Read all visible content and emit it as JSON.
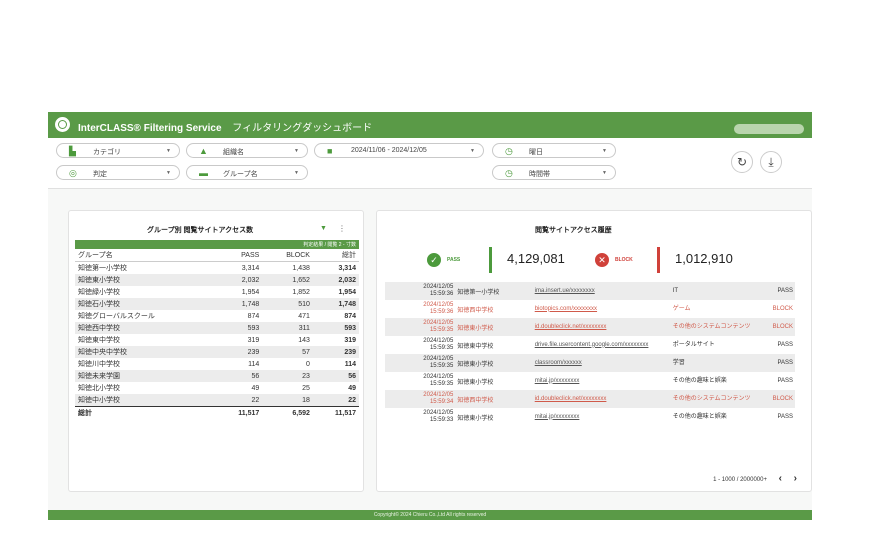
{
  "header": {
    "title": "InterCLASS® Filtering Service",
    "subtitle": "フィルタリングダッシュボード",
    "tiny_text": "",
    "button_label": ""
  },
  "filters": {
    "category": "カテゴリ",
    "school": "組織名",
    "date_range": "2024/11/06 - 2024/12/05",
    "day": "曜日",
    "judgment": "判定",
    "group": "グループ名",
    "time": "時間帯"
  },
  "group_card": {
    "title": "グループ別 閲覧サイトアクセス数",
    "subheader": "判定結果 / 閲覧 2 - 寸数",
    "columns": [
      "グループ名",
      "PASS",
      "BLOCK",
      "総計"
    ],
    "rows": [
      {
        "name": "知徳第一小学校",
        "pass": "3,314",
        "block": "1,438",
        "total": "3,314"
      },
      {
        "name": "知徳東小学校",
        "pass": "2,032",
        "block": "1,652",
        "total": "2,032"
      },
      {
        "name": "知徳緑小学校",
        "pass": "1,954",
        "block": "1,852",
        "total": "1,954"
      },
      {
        "name": "知徳石小学校",
        "pass": "1,748",
        "block": "510",
        "total": "1,748"
      },
      {
        "name": "知徳グローバルスクール",
        "pass": "874",
        "block": "471",
        "total": "874"
      },
      {
        "name": "知徳西中学校",
        "pass": "593",
        "block": "311",
        "total": "593"
      },
      {
        "name": "知徳東中学校",
        "pass": "319",
        "block": "143",
        "total": "319"
      },
      {
        "name": "知徳中央中学校",
        "pass": "239",
        "block": "57",
        "total": "239"
      },
      {
        "name": "知徳川中学校",
        "pass": "114",
        "block": "0",
        "total": "114"
      },
      {
        "name": "知徳未来学園",
        "pass": "56",
        "block": "23",
        "total": "56"
      },
      {
        "name": "知徳北小学校",
        "pass": "49",
        "block": "25",
        "total": "49"
      },
      {
        "name": "知徳中小学校",
        "pass": "22",
        "block": "18",
        "total": "22"
      }
    ],
    "sum": {
      "name": "総計",
      "pass": "11,517",
      "block": "6,592",
      "total": "11,517"
    }
  },
  "access_card": {
    "title": "閲覧サイトアクセス履歴",
    "pass_label": "PASS",
    "pass_value": "4,129,081",
    "block_label": "BLOCK",
    "block_value": "1,012,910",
    "colors": {
      "pass": "#4c9a3c",
      "block": "#d0413a"
    },
    "rows": [
      {
        "date": "2024/12/05",
        "time": "15:59:36",
        "group": "知徳第一小学校",
        "url": "ima.insert.ue/xxxxxxxx",
        "category": "IT",
        "result": "PASS",
        "blocked": false
      },
      {
        "date": "2024/12/05",
        "time": "15:59:36",
        "group": "知徳西中学校",
        "url": "biotopics.com/xxxxxxxx",
        "category": "ゲーム",
        "result": "BLOCK",
        "blocked": true
      },
      {
        "date": "2024/12/05",
        "time": "15:59:35",
        "group": "知徳東小学校",
        "url": "id.doubleclick.net/xxxxxxxx",
        "category": "その他のシステムコンテンツ",
        "result": "BLOCK",
        "blocked": true
      },
      {
        "date": "2024/12/05",
        "time": "15:59:35",
        "group": "知徳東中学校",
        "url": "drive.file.usercontent.google.com/xxxxxxxx",
        "category": "ポータルサイト",
        "result": "PASS",
        "blocked": false
      },
      {
        "date": "2024/12/05",
        "time": "15:59:35",
        "group": "知徳東小学校",
        "url": "classroom/xxxxxx",
        "category": "学習",
        "result": "PASS",
        "blocked": false
      },
      {
        "date": "2024/12/05",
        "time": "15:59:35",
        "group": "知徳東小学校",
        "url": "mitai.jp/xxxxxxxx",
        "category": "その他の趣味と娯楽",
        "result": "PASS",
        "blocked": false
      },
      {
        "date": "2024/12/05",
        "time": "15:59:34",
        "group": "知徳西中学校",
        "url": "id.doubleclick.net/xxxxxxxx",
        "category": "その他のシステムコンテンツ",
        "result": "BLOCK",
        "blocked": true
      },
      {
        "date": "2024/12/05",
        "time": "15:59:33",
        "group": "知徳東小学校",
        "url": "mitai.jp/xxxxxxxx",
        "category": "その他の趣味と娯楽",
        "result": "PASS",
        "blocked": false
      }
    ],
    "pager": "1 - 1000 / 2000000+",
    "prev": "‹",
    "next": "›"
  },
  "footer": {
    "text": "Copyright© 2024 Chieru Co.,Ltd All rights reserved"
  }
}
